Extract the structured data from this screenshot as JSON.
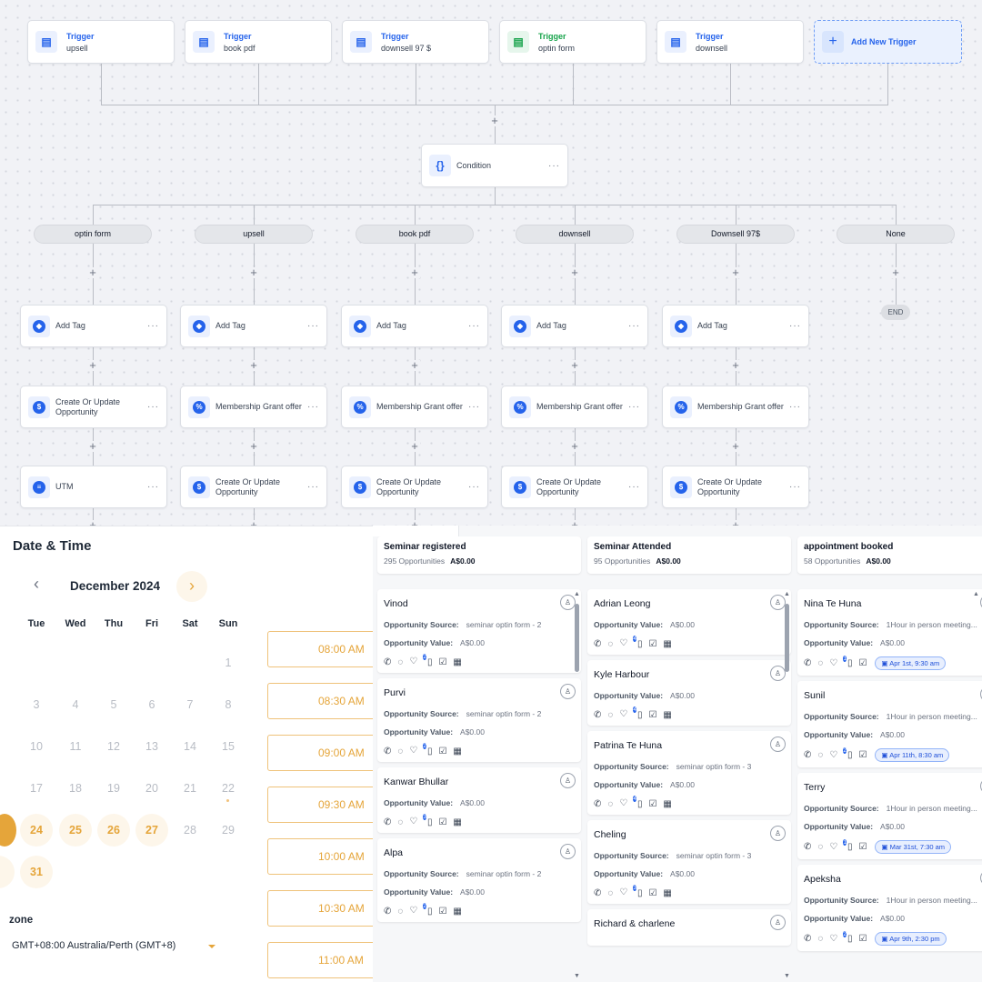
{
  "workflow": {
    "triggers": [
      {
        "title": "Trigger",
        "subtitle": "upsell",
        "color": "#2563eb"
      },
      {
        "title": "Trigger",
        "subtitle": "book pdf",
        "color": "#2563eb"
      },
      {
        "title": "Trigger",
        "subtitle": "downsell 97 $",
        "color": "#2563eb"
      },
      {
        "title": "Trigger",
        "subtitle": "optin form",
        "color": "#16a34a"
      },
      {
        "title": "Trigger",
        "subtitle": "downsell",
        "color": "#2563eb"
      }
    ],
    "add_trigger_label": "Add New Trigger",
    "condition_label": "Condition",
    "branches": [
      "optin form",
      "upsell",
      "book pdf",
      "downsell",
      "Downsell 97$",
      "None"
    ],
    "end_label": "END",
    "actions": [
      [
        {
          "label": "Add Tag",
          "icon": "tag-icon"
        },
        {
          "label": "Create Or Update Opportunity",
          "icon": "dollar-icon"
        },
        {
          "label": "UTM",
          "icon": "user-list-icon"
        }
      ],
      [
        {
          "label": "Add Tag",
          "icon": "tag-icon"
        },
        {
          "label": "Membership Grant offer",
          "icon": "offer-badge-icon"
        },
        {
          "label": "Create Or Update Opportunity",
          "icon": "dollar-icon"
        }
      ],
      [
        {
          "label": "Add Tag",
          "icon": "tag-icon"
        },
        {
          "label": "Membership Grant offer",
          "icon": "offer-badge-icon"
        },
        {
          "label": "Create Or Update Opportunity",
          "icon": "dollar-icon"
        }
      ],
      [
        {
          "label": "Add Tag",
          "icon": "tag-icon"
        },
        {
          "label": "Membership Grant offer",
          "icon": "offer-badge-icon"
        },
        {
          "label": "Create Or Update Opportunity",
          "icon": "dollar-icon"
        }
      ],
      [
        {
          "label": "Add Tag",
          "icon": "tag-icon"
        },
        {
          "label": "Membership Grant offer",
          "icon": "offer-badge-icon"
        },
        {
          "label": "Create Or Update Opportunity",
          "icon": "dollar-icon"
        }
      ]
    ]
  },
  "calendar": {
    "title": "Date & Time",
    "month": "December 2024",
    "weekdays": [
      "Tue",
      "Wed",
      "Thu",
      "Fri",
      "Sat",
      "Sun"
    ],
    "weeks": [
      [
        "",
        "",
        "",
        "",
        "",
        "1"
      ],
      [
        "3",
        "4",
        "5",
        "6",
        "7",
        "8"
      ],
      [
        "10",
        "11",
        "12",
        "13",
        "14",
        "15"
      ],
      [
        "17",
        "18",
        "19",
        "20",
        "21",
        "22"
      ],
      [
        "24",
        "25",
        "26",
        "27",
        "28",
        "29"
      ],
      [
        "31",
        "",
        "",
        "",
        "",
        ""
      ]
    ],
    "available": [
      "24",
      "25",
      "26",
      "27",
      "31"
    ],
    "time_slots": [
      "08:00 AM",
      "08:30 AM",
      "09:00 AM",
      "09:30 AM",
      "10:00 AM",
      "10:30 AM",
      "11:00 AM"
    ],
    "zone_label": "zone",
    "timezone": "GMT+08:00 Australia/Perth (GMT+8)",
    "accent": "#e5a53a"
  },
  "pipeline": {
    "source_label": "Opportunity Source:",
    "value_label": "Opportunity Value:",
    "columns": [
      {
        "name": "Seminar registered",
        "count": "295 Opportunities",
        "total": "A$0.00",
        "cards": [
          {
            "name": "Vinod",
            "source": "seminar optin form - 2",
            "value": "A$0.00",
            "badge": "2"
          },
          {
            "name": "Purvi",
            "source": "seminar optin form - 2",
            "value": "A$0.00",
            "badge": "2"
          },
          {
            "name": "Kanwar Bhullar",
            "value": "A$0.00",
            "badge": "3"
          },
          {
            "name": "Alpa",
            "source": "seminar optin form - 2",
            "value": "A$0.00",
            "badge": "2"
          }
        ]
      },
      {
        "name": "Seminar Attended",
        "count": "95 Opportunities",
        "total": "A$0.00",
        "cards": [
          {
            "name": "Adrian Leong",
            "value": "A$0.00",
            "badge": "4"
          },
          {
            "name": "Kyle Harbour",
            "value": "A$0.00",
            "badge": "4"
          },
          {
            "name": "Patrina Te Huna",
            "source": "seminar optin form - 3",
            "value": "A$0.00",
            "badge": "4"
          },
          {
            "name": "Cheling",
            "source": "seminar optin form - 3",
            "value": "A$0.00",
            "badge": "3"
          },
          {
            "name": "Richard & charlene"
          }
        ]
      },
      {
        "name": "appointment booked",
        "count": "58 Opportunities",
        "total": "A$0.00",
        "cards": [
          {
            "name": "Nina Te Huna",
            "source": "1Hour in person meeting...",
            "value": "A$0.00",
            "badge": "1",
            "appt": "Apr 1st, 9:30 am"
          },
          {
            "name": "Sunil",
            "source": "1Hour in person meeting...",
            "value": "A$0.00",
            "badge": "2",
            "appt": "Apr 11th, 8:30 am"
          },
          {
            "name": "Terry",
            "source": "1Hour in person meeting...",
            "value": "A$0.00",
            "badge": "1",
            "appt": "Mar 31st, 7:30 am"
          },
          {
            "name": "Apeksha",
            "source": "1Hour in person meeting...",
            "value": "A$0.00",
            "badge": "2",
            "appt": "Apr 9th, 2:30 pm"
          }
        ]
      }
    ]
  }
}
